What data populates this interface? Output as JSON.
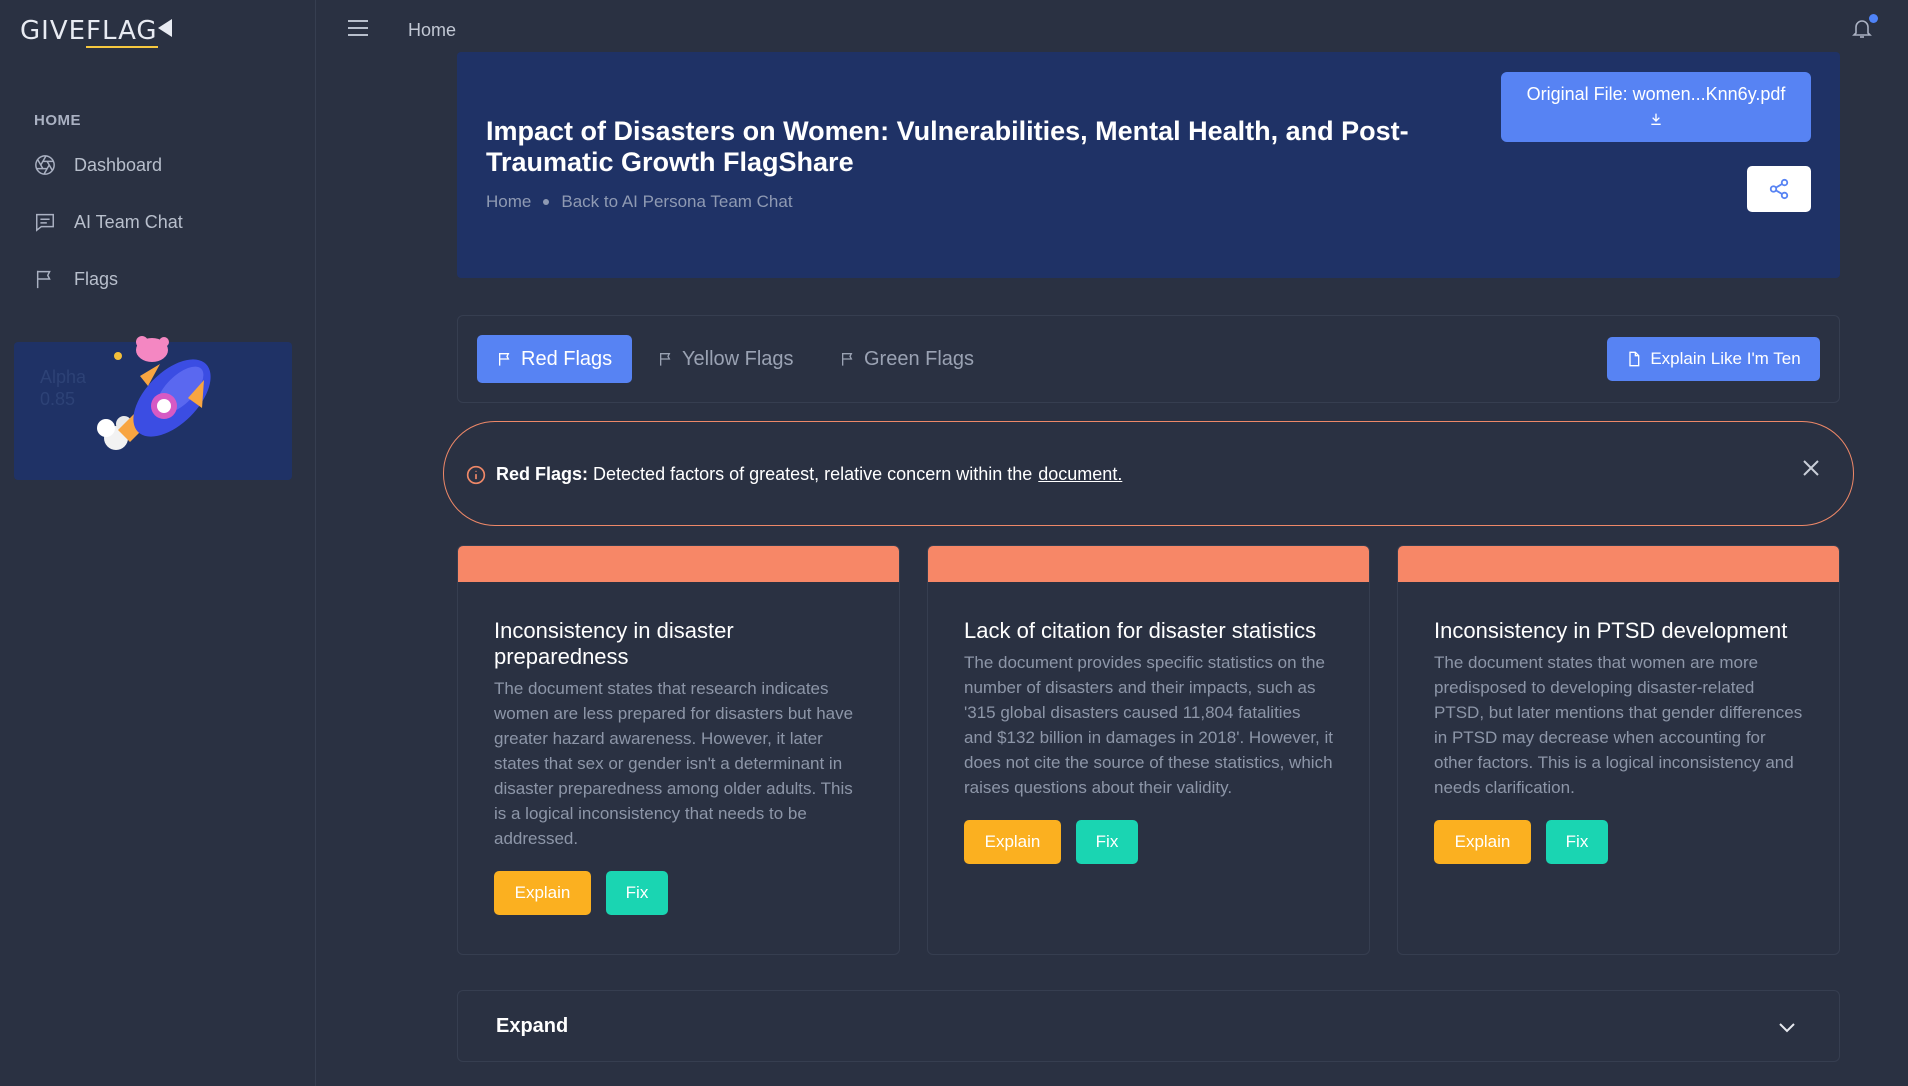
{
  "app": {
    "logo_left": "GIVE",
    "logo_right": "FLAG"
  },
  "sidebar": {
    "section": "HOME",
    "items": [
      {
        "label": "Dashboard",
        "icon": "aperture-icon"
      },
      {
        "label": "AI Team Chat",
        "icon": "chat-icon"
      },
      {
        "label": "Flags",
        "icon": "flag-icon"
      }
    ],
    "promo": {
      "line1": "Alpha",
      "line2": "0.85"
    }
  },
  "topbar": {
    "breadcrumb": "Home",
    "notification_icon": "bell-icon"
  },
  "hero": {
    "title": "Impact of Disasters on Women: Vulnerabilities, Mental Health, and Post-Traumatic Growth FlagShare",
    "crumb_home": "Home",
    "crumb_back": "Back to AI Persona Team Chat",
    "original_file": "Original File: women...Knn6y.pdf"
  },
  "tabs": {
    "red": "Red Flags",
    "yellow": "Yellow Flags",
    "green": "Green Flags",
    "eli": "Explain Like I'm Ten"
  },
  "alert": {
    "bold": "Red Flags:",
    "text": "Detected factors of greatest, relative concern within the",
    "link": "document."
  },
  "cards": [
    {
      "title": "Inconsistency in disaster preparedness",
      "body": "The document states that research indicates women are less prepared for disasters but have greater hazard awareness. However, it later states that sex or gender isn't a determinant in disaster preparedness among older adults. This is a logical inconsistency that needs to be addressed.",
      "explain": "Explain",
      "fix": "Fix"
    },
    {
      "title": "Lack of citation for disaster statistics",
      "body": "The document provides specific statistics on the number of disasters and their impacts, such as '315 global disasters caused 11,804 fatalities and $132 billion in damages in 2018'. However, it does not cite the source of these statistics, which raises questions about their validity.",
      "explain": "Explain",
      "fix": "Fix"
    },
    {
      "title": "Inconsistency in PTSD development",
      "body": "The document states that women are more predisposed to developing disaster-related PTSD, but later mentions that gender differences in PTSD may decrease when accounting for other factors. This is a logical inconsistency and needs clarification.",
      "explain": "Explain",
      "fix": "Fix"
    }
  ],
  "expand": {
    "label": "Expand"
  },
  "colors": {
    "background": "#2a3142",
    "hero": "#1f3266",
    "primary": "#5783f3",
    "red_flag": "#f78767",
    "explain": "#fbb020",
    "fix": "#1ad5b2"
  }
}
